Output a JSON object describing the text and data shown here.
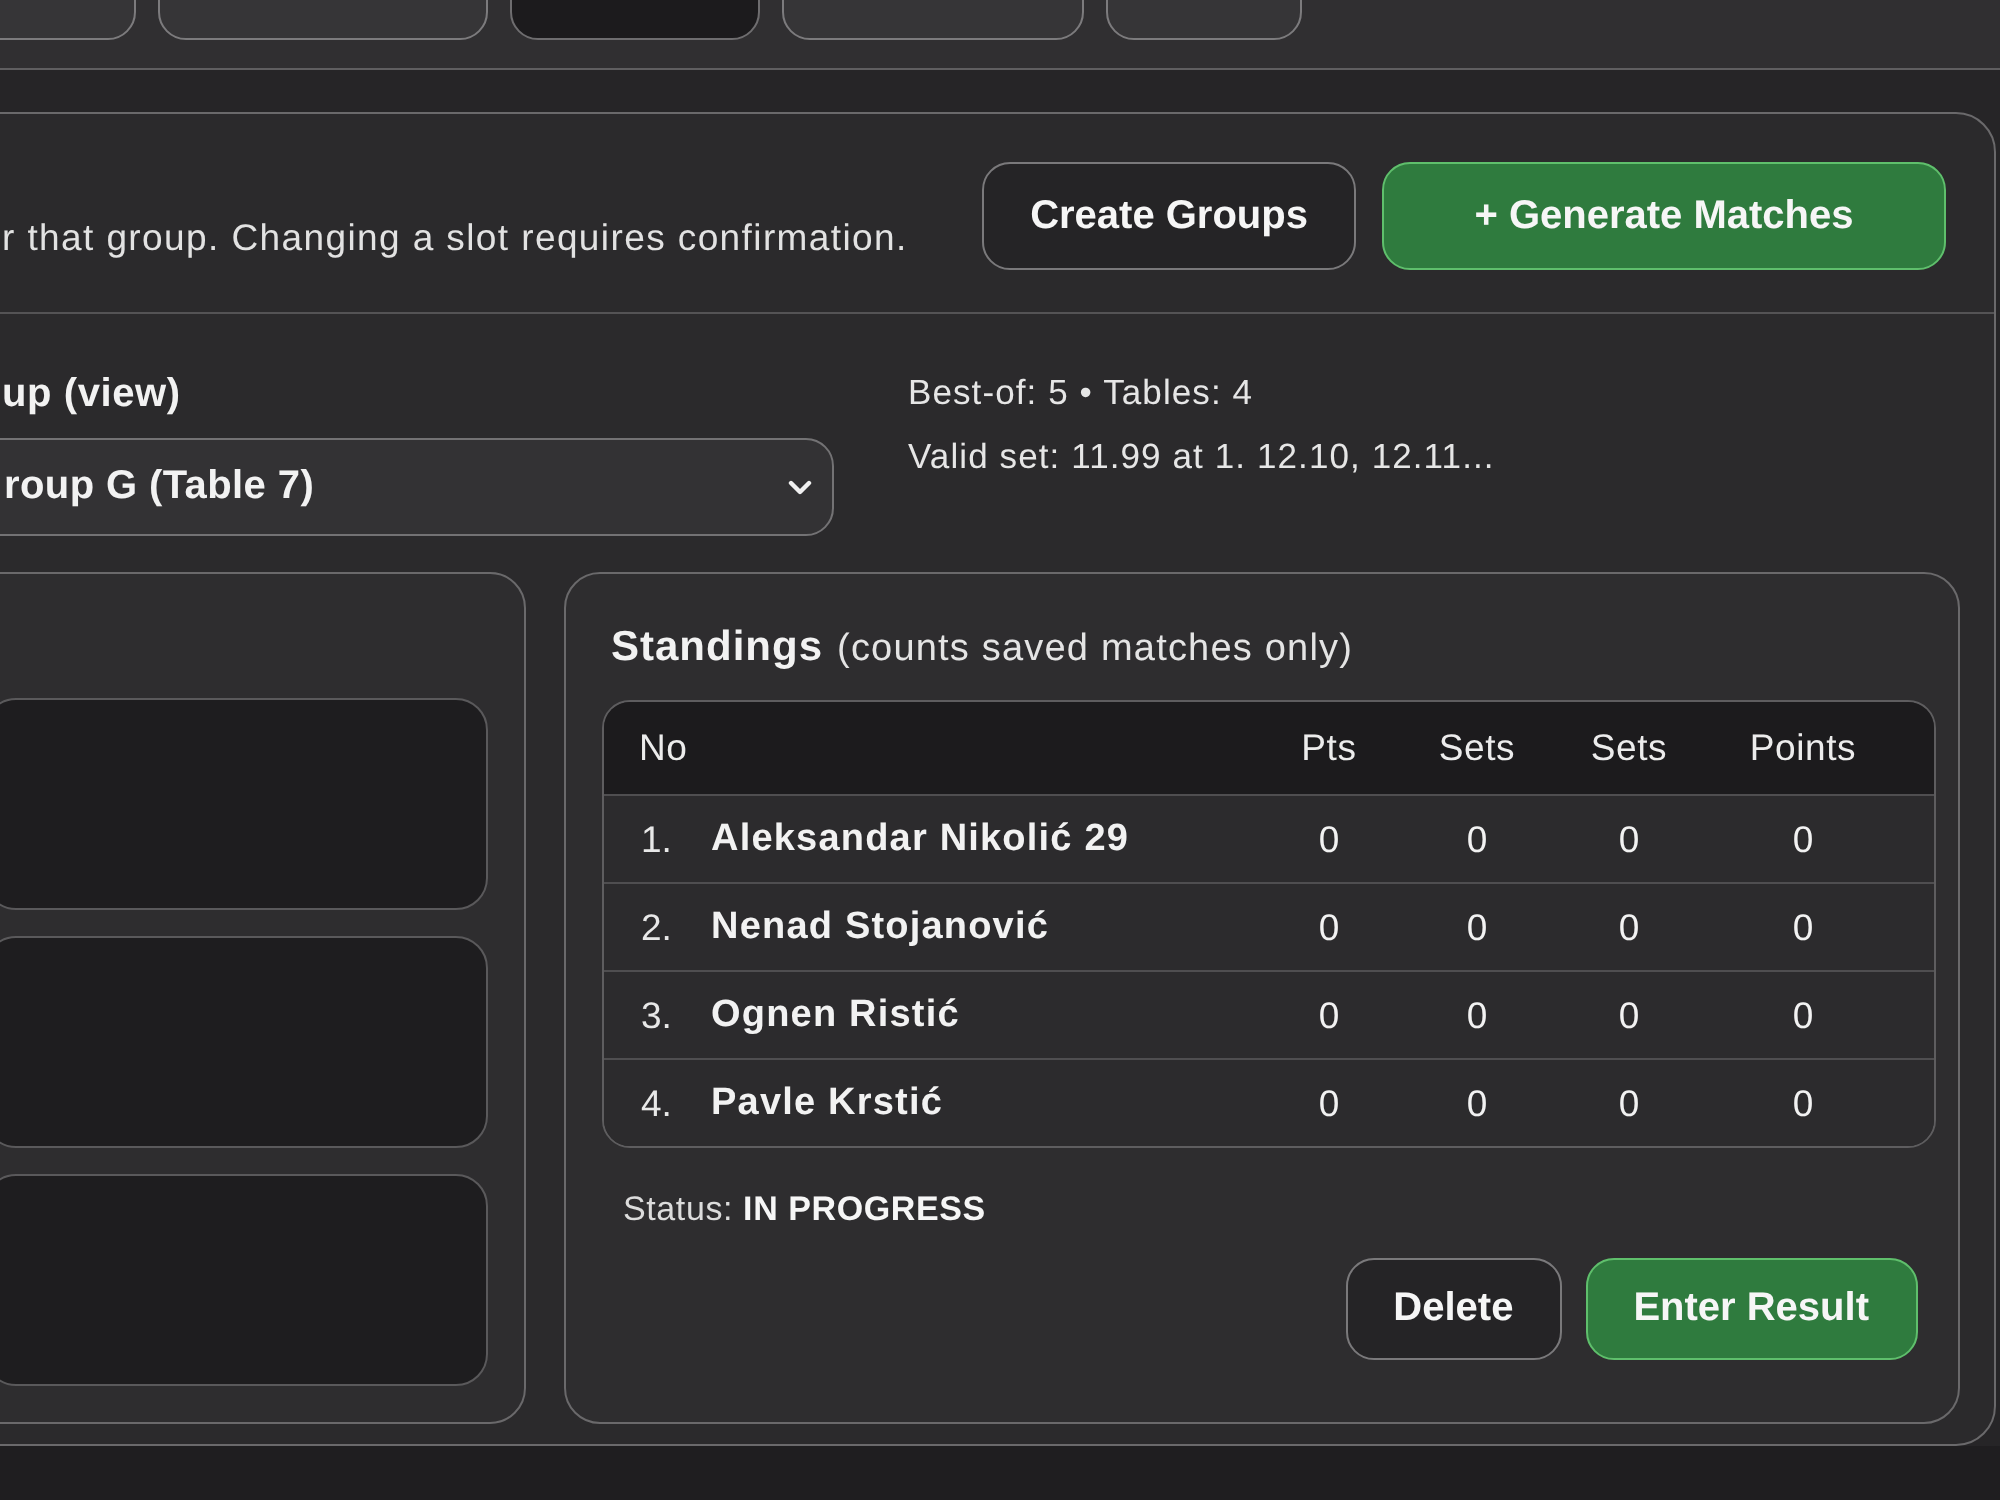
{
  "tabs": [
    {
      "selected": false
    },
    {
      "selected": false
    },
    {
      "selected": true
    },
    {
      "selected": false
    },
    {
      "selected": false
    }
  ],
  "header": {
    "description": "r that group. Changing a slot requires confirmation.",
    "buttons": [
      {
        "label": "Create Groups",
        "kind": "secondary"
      },
      {
        "label": "+ Generate Matches",
        "kind": "primary"
      }
    ]
  },
  "group_select": {
    "label": "up (view)",
    "value": "roup G (Table 7)"
  },
  "info": [
    "Best-of: 5 • Tables: 4",
    "Valid set: 11.99 at 1. 12.10, 12.11..."
  ],
  "slots": [
    {
      "empty": true
    },
    {
      "empty": true
    },
    {
      "empty": true
    }
  ],
  "standings": {
    "title": "Standings",
    "note": "(counts saved matches only)",
    "columns": [
      "No",
      "Pts",
      "Sets",
      "Sets",
      "Points"
    ],
    "rows": [
      {
        "no": "1.",
        "name": "Aleksandar Nikolić 29",
        "values": [
          "0",
          "0",
          "0",
          "0"
        ]
      },
      {
        "no": "2.",
        "name": "Nenad Stojanović",
        "values": [
          "0",
          "0",
          "0",
          "0"
        ]
      },
      {
        "no": "3.",
        "name": "Ognen Ristić",
        "values": [
          "0",
          "0",
          "0",
          "0"
        ]
      },
      {
        "no": "4.",
        "name": "Pavle Krstić",
        "values": [
          "0",
          "0",
          "0",
          "0"
        ]
      }
    ],
    "status": "Status: **IN PROGRESS**",
    "buttons": [
      {
        "label": "Delete",
        "kind": "secondary"
      },
      {
        "label": "Enter Result",
        "kind": "primary"
      }
    ]
  }
}
